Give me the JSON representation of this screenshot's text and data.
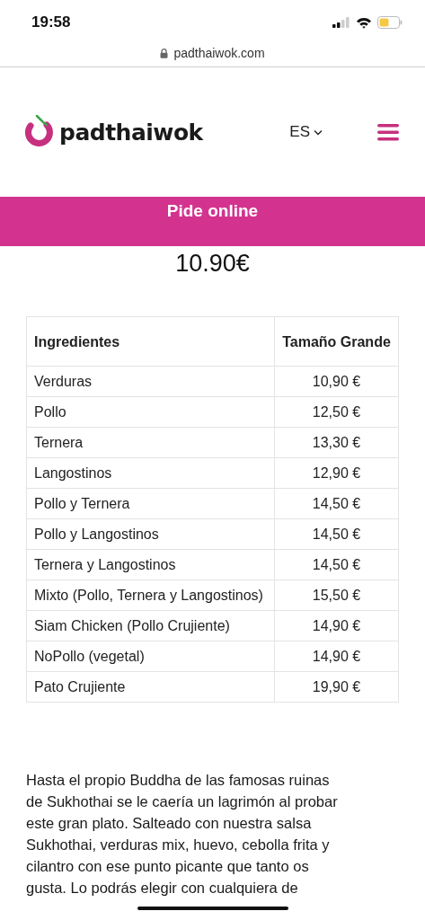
{
  "status_bar": {
    "time": "19:58"
  },
  "browser": {
    "url": "padthaiwok.com"
  },
  "header": {
    "logo_text": "padthaiwok",
    "language": "ES"
  },
  "banner": {
    "title": "Pide online"
  },
  "price": "10.90€",
  "table": {
    "columns": [
      "Ingredientes",
      "Tamaño Grande"
    ],
    "rows": [
      {
        "name": "Verduras",
        "price": "10,90 €"
      },
      {
        "name": "Pollo",
        "price": "12,50 €"
      },
      {
        "name": "Ternera",
        "price": "13,30 €"
      },
      {
        "name": "Langostinos",
        "price": "12,90 €"
      },
      {
        "name": "Pollo y Ternera",
        "price": "14,50 €"
      },
      {
        "name": "Pollo y Langostinos",
        "price": "14,50 €"
      },
      {
        "name": "Ternera y Langostinos",
        "price": "14,50 €"
      },
      {
        "name": "Mixto (Pollo, Ternera y Langostinos)",
        "price": "15,50 €"
      },
      {
        "name": "Siam Chicken (Pollo Crujiente)",
        "price": "14,90 €"
      },
      {
        "name": "NoPollo (vegetal)",
        "price": "14,90 €"
      },
      {
        "name": "Pato Crujiente",
        "price": "19,90 €"
      }
    ]
  },
  "description": [
    "Hasta el propio Buddha de las famosas ruinas",
    "de Sukhothai se le caería un lagrimón al probar",
    "este gran plato. Salteado con nuestra salsa",
    "Sukhothai, verduras mix, huevo, cebolla frita y",
    "cilantro con ese punto picante que tanto os",
    "gusta. Lo podrás elegir con cualquiera de"
  ]
}
